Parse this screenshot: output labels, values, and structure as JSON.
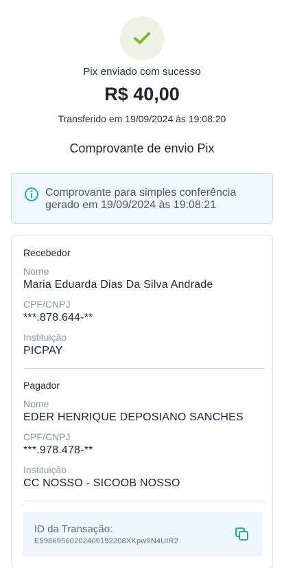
{
  "status": {
    "message": "Pix enviado com sucesso",
    "amount": "R$ 40,00",
    "transferred_at": "Transferido em 19/09/2024 às 19:08:20",
    "icon": "check-icon"
  },
  "receipt": {
    "title": "Comprovante de envio Pix"
  },
  "info": {
    "icon": "info-icon",
    "line1": "Comprovante para simples conferência",
    "line2": "gerado em 19/09/2024 às 19:08:21"
  },
  "recipient": {
    "section_title": "Recebedor",
    "name_label": "Nome",
    "name": "Maria Eduarda Dias Da Silva Andrade",
    "doc_label": "CPF/CNPJ",
    "doc": "***.878.644-**",
    "institution_label": "Instituição",
    "institution": "PICPAY"
  },
  "payer": {
    "section_title": "Pagador",
    "name_label": "Nome",
    "name": "EDER HENRIQUE DEPOSIANO SANCHES",
    "doc_label": "CPF/CNPJ",
    "doc": "***.978.478-**",
    "institution_label": "Instituição",
    "institution": "CC NOSSO - SICOOB NOSSO"
  },
  "transaction": {
    "label": "ID da Transação:",
    "id": "E59869560202409192208XKpw9N4UIR2",
    "copy_icon": "copy-icon"
  },
  "colors": {
    "success_green": "#7ab829",
    "info_blue": "#2aa3d6",
    "copy_teal": "#1593b8"
  }
}
